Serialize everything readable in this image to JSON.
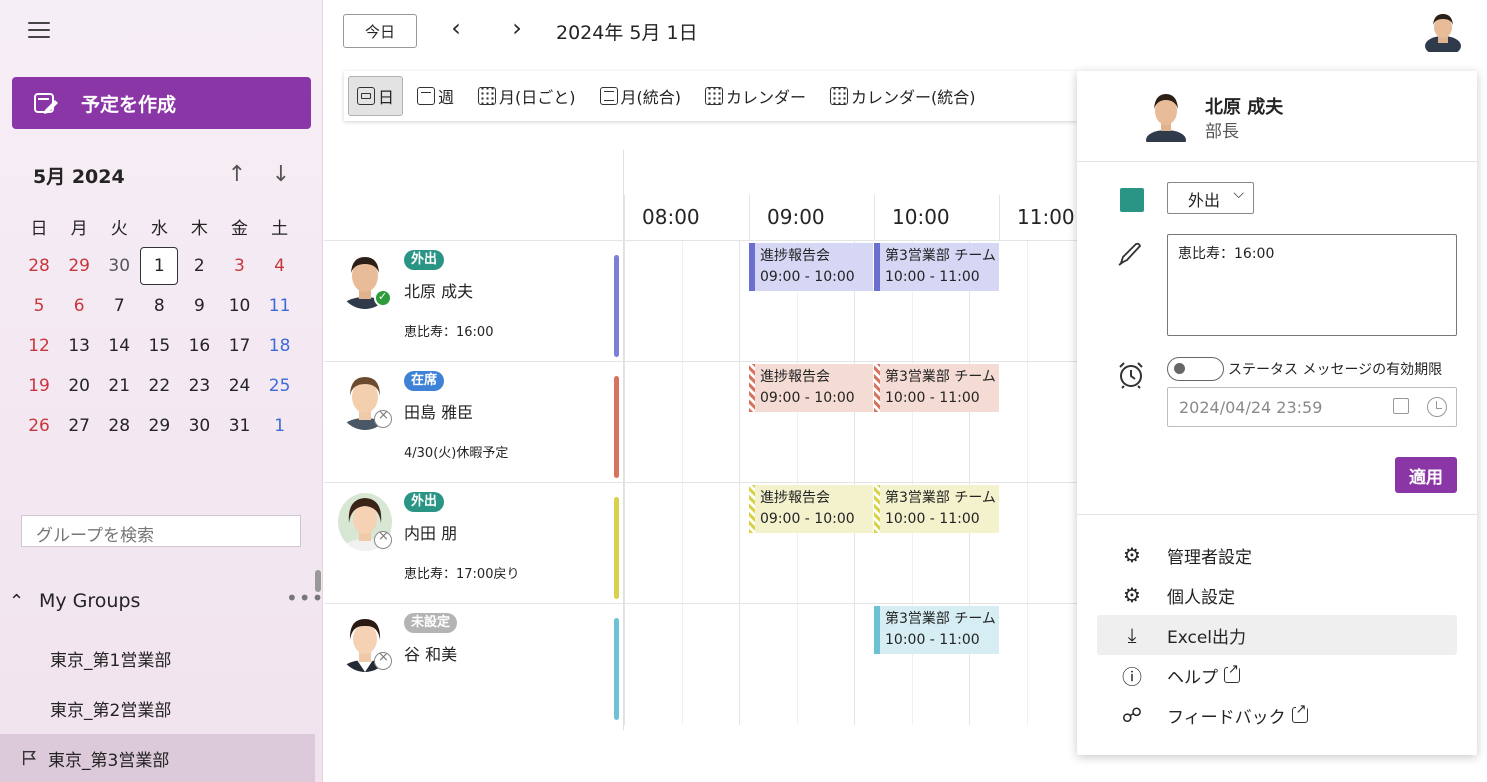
{
  "sidebar": {
    "create_label": "予定を作成",
    "month_title": "5月 2024",
    "weekdays": [
      "日",
      "月",
      "火",
      "水",
      "木",
      "金",
      "土"
    ],
    "weeks": [
      [
        "28",
        "29",
        "30",
        "1",
        "2",
        "3",
        "4"
      ],
      [
        "5",
        "6",
        "7",
        "8",
        "9",
        "10",
        "11"
      ],
      [
        "12",
        "13",
        "14",
        "15",
        "16",
        "17",
        "18"
      ],
      [
        "19",
        "20",
        "21",
        "22",
        "23",
        "24",
        "25"
      ],
      [
        "26",
        "27",
        "28",
        "29",
        "30",
        "31",
        "1"
      ]
    ],
    "search_placeholder": "グループを検索",
    "my_groups_label": "My Groups",
    "groups": [
      "東京_第1営業部",
      "東京_第2営業部",
      "東京_第3営業部"
    ]
  },
  "header": {
    "today_label": "今日",
    "date_title": "2024年 5月 1日"
  },
  "view_tabs": [
    "日",
    "週",
    "月(日ごと)",
    "月(統合)",
    "カレンダー",
    "カレンダー(統合)"
  ],
  "time_slots": [
    "08:00",
    "09:00",
    "10:00",
    "11:00"
  ],
  "people": [
    {
      "name": "北原 成夫",
      "status": "外出",
      "status_color": "#2a9485",
      "message": "恵比寿：16:00",
      "bar_color": "#7b7fd6",
      "events": [
        {
          "title": "進捗報告会",
          "time": "09:00 - 10:00",
          "bg": "#d5d7f5",
          "stripe": "#6b70d0"
        },
        {
          "title": "第3営業部 チーム",
          "time": "10:00 - 11:00",
          "bg": "#d5d7f5",
          "stripe": "#6b70d0"
        }
      ]
    },
    {
      "name": "田島 雅臣",
      "status": "在席",
      "status_color": "#3d82d6",
      "message": "4/30(火)休暇予定",
      "bar_color": "#d6745f",
      "events": [
        {
          "title": "進捗報告会",
          "time": "09:00 - 10:00",
          "bg": "#f4dbd4",
          "stripe": "hatch-red"
        },
        {
          "title": "第3営業部 チーム",
          "time": "10:00 - 11:00",
          "bg": "#f4dbd4",
          "stripe": "hatch-red"
        }
      ]
    },
    {
      "name": "内田 朋",
      "status": "外出",
      "status_color": "#2a9485",
      "message": "恵比寿：17:00戻り",
      "bar_color": "#d7d24a",
      "events": [
        {
          "title": "進捗報告会",
          "time": "09:00 - 10:00",
          "bg": "#f3f2cd",
          "stripe": "hatch-yel"
        },
        {
          "title": "第3営業部 チーム",
          "time": "10:00 - 11:00",
          "bg": "#f3f2cd",
          "stripe": "hatch-yel"
        }
      ]
    },
    {
      "name": "谷 和美",
      "status": "未設定",
      "status_color": "#b4b4b4",
      "message": "",
      "bar_color": "#6cc2d3",
      "events": [
        {
          "title": "第3営業部 チーム",
          "time": "10:00 - 11:00",
          "bg": "#d6eef3",
          "stripe": "#6cc2d3"
        }
      ]
    }
  ],
  "panel": {
    "name": "北原 成夫",
    "title": "部長",
    "status_value": "外出",
    "status_message": "恵比寿：16:00",
    "expiry_label": "ステータス メッセージの有効期限",
    "expiry_value": "2024/04/24 23:59",
    "apply_label": "適用",
    "menu": [
      "管理者設定",
      "個人設定",
      "Excel出力",
      "ヘルプ",
      "フィードバック"
    ]
  },
  "colors": {
    "accent": "#8a36a6",
    "teal": "#2a9485"
  }
}
